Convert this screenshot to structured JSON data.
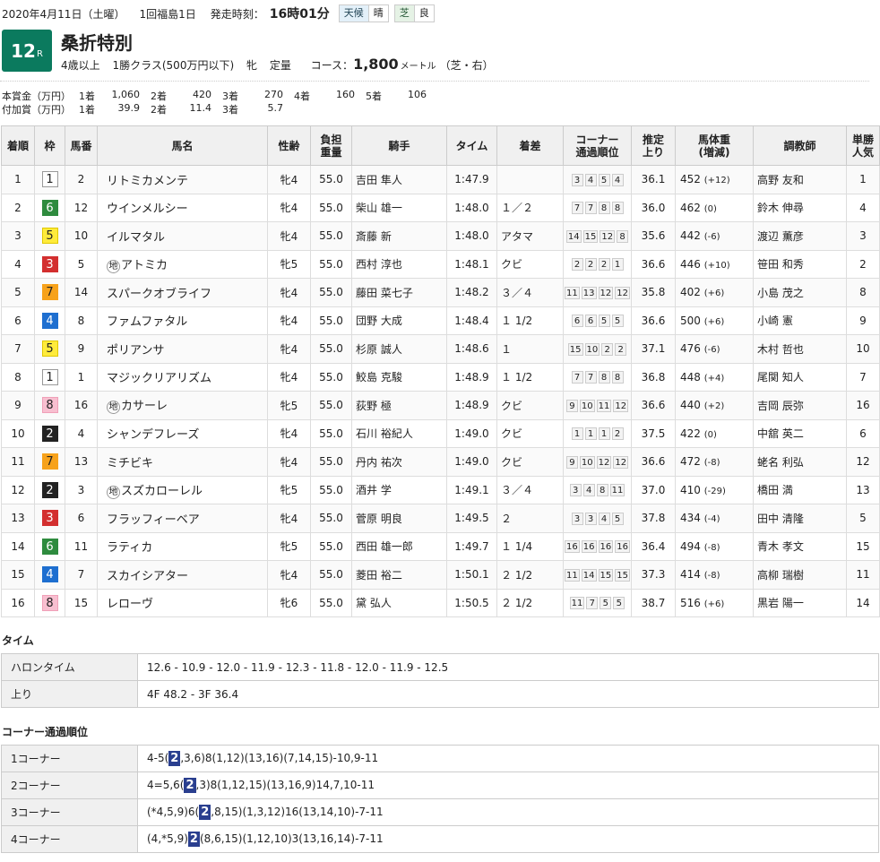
{
  "header": {
    "date": "2020年4月11日（土曜）",
    "meeting": "1回福島1日",
    "start_label": "発走時刻：",
    "start_time": "16時01分",
    "weather_label": "天候",
    "weather": "晴",
    "surface_label": "芝",
    "going": "良"
  },
  "race": {
    "number": "12",
    "suffix": "R",
    "name": "桑折特別",
    "age_cond": "4歳以上",
    "class": "1勝クラス(500万円以下)",
    "sex": "牝",
    "weight_rule": "定量",
    "course_label": "コース：",
    "distance": "1,800",
    "distance_unit": "メートル",
    "course_detail": "（芝・右）"
  },
  "prize": {
    "main_label": "本賞金（万円）",
    "main": [
      {
        "place": "1着",
        "value": "1,060"
      },
      {
        "place": "2着",
        "value": "420"
      },
      {
        "place": "3着",
        "value": "270"
      },
      {
        "place": "4着",
        "value": "160"
      },
      {
        "place": "5着",
        "value": "106"
      }
    ],
    "extra_label": "付加賞（万円）",
    "extra": [
      {
        "place": "1着",
        "value": "39.9"
      },
      {
        "place": "2着",
        "value": "11.4"
      },
      {
        "place": "3着",
        "value": "5.7"
      }
    ]
  },
  "columns": {
    "rank": "着順",
    "frame": "枠",
    "horse_no": "馬番",
    "name": "馬名",
    "sex_age": "性齢",
    "weight_top": "負担",
    "weight_bottom": "重量",
    "jockey": "騎手",
    "time": "タイム",
    "margin": "着差",
    "corner_top": "コーナー",
    "corner_bottom": "通過順位",
    "last3f_top": "推定",
    "last3f_bottom": "上り",
    "body_top": "馬体重",
    "body_bottom": "(増減)",
    "trainer": "調教師",
    "pop_top": "単勝",
    "pop_bottom": "人気"
  },
  "chihou_mark": "地",
  "frame_colors": {
    "1": {
      "bg": "#ffffff",
      "fg": "#222222",
      "border": "#999999"
    },
    "2": {
      "bg": "#222222",
      "fg": "#ffffff",
      "border": "#222222"
    },
    "3": {
      "bg": "#d32f2f",
      "fg": "#ffffff",
      "border": "#d32f2f"
    },
    "4": {
      "bg": "#1e6fd0",
      "fg": "#ffffff",
      "border": "#1e6fd0"
    },
    "5": {
      "bg": "#ffeb3b",
      "fg": "#222222",
      "border": "#e0c800"
    },
    "6": {
      "bg": "#2e8b3e",
      "fg": "#ffffff",
      "border": "#2e8b3e"
    },
    "7": {
      "bg": "#f7a21b",
      "fg": "#222222",
      "border": "#f7a21b"
    },
    "8": {
      "bg": "#f8bfd0",
      "fg": "#222222",
      "border": "#f0a0b8"
    }
  },
  "results": [
    {
      "rank": "1",
      "frame": "1",
      "no": "2",
      "chihou": false,
      "name": "リトミカメンテ",
      "sex_age": "牝4",
      "weight": "55.0",
      "jockey": "吉田 隼人",
      "time": "1:47.9",
      "margin": "",
      "corners": [
        "3",
        "4",
        "5",
        "4"
      ],
      "last3f": "36.1",
      "body": "452",
      "diff": "(+12)",
      "trainer": "高野 友和",
      "pop": "1"
    },
    {
      "rank": "2",
      "frame": "6",
      "no": "12",
      "chihou": false,
      "name": "ウインメルシー",
      "sex_age": "牝4",
      "weight": "55.0",
      "jockey": "柴山 雄一",
      "time": "1:48.0",
      "margin": "１／２",
      "corners": [
        "7",
        "7",
        "8",
        "8"
      ],
      "last3f": "36.0",
      "body": "462",
      "diff": "(0)",
      "trainer": "鈴木 伸尋",
      "pop": "4"
    },
    {
      "rank": "3",
      "frame": "5",
      "no": "10",
      "chihou": false,
      "name": "イルマタル",
      "sex_age": "牝4",
      "weight": "55.0",
      "jockey": "斎藤 新",
      "time": "1:48.0",
      "margin": "アタマ",
      "corners": [
        "14",
        "15",
        "12",
        "8"
      ],
      "last3f": "35.6",
      "body": "442",
      "diff": "(-6)",
      "trainer": "渡辺 薫彦",
      "pop": "3"
    },
    {
      "rank": "4",
      "frame": "3",
      "no": "5",
      "chihou": true,
      "name": "アトミカ",
      "sex_age": "牝5",
      "weight": "55.0",
      "jockey": "西村 淳也",
      "time": "1:48.1",
      "margin": "クビ",
      "corners": [
        "2",
        "2",
        "2",
        "1"
      ],
      "last3f": "36.6",
      "body": "446",
      "diff": "(+10)",
      "trainer": "笹田 和秀",
      "pop": "2"
    },
    {
      "rank": "5",
      "frame": "7",
      "no": "14",
      "chihou": false,
      "name": "スパークオブライフ",
      "sex_age": "牝4",
      "weight": "55.0",
      "jockey": "藤田 菜七子",
      "time": "1:48.2",
      "margin": "３／４",
      "corners": [
        "11",
        "13",
        "12",
        "12"
      ],
      "last3f": "35.8",
      "body": "402",
      "diff": "(+6)",
      "trainer": "小島 茂之",
      "pop": "8"
    },
    {
      "rank": "6",
      "frame": "4",
      "no": "8",
      "chihou": false,
      "name": "ファムファタル",
      "sex_age": "牝4",
      "weight": "55.0",
      "jockey": "団野 大成",
      "time": "1:48.4",
      "margin": "１ 1/2",
      "corners": [
        "6",
        "6",
        "5",
        "5"
      ],
      "last3f": "36.6",
      "body": "500",
      "diff": "(+6)",
      "trainer": "小崎 憲",
      "pop": "9"
    },
    {
      "rank": "7",
      "frame": "5",
      "no": "9",
      "chihou": false,
      "name": "ポリアンサ",
      "sex_age": "牝4",
      "weight": "55.0",
      "jockey": "杉原 誠人",
      "time": "1:48.6",
      "margin": "１",
      "corners": [
        "15",
        "10",
        "2",
        "2"
      ],
      "last3f": "37.1",
      "body": "476",
      "diff": "(-6)",
      "trainer": "木村 哲也",
      "pop": "10"
    },
    {
      "rank": "8",
      "frame": "1",
      "no": "1",
      "chihou": false,
      "name": "マジックリアリズム",
      "sex_age": "牝4",
      "weight": "55.0",
      "jockey": "鮫島 克駿",
      "time": "1:48.9",
      "margin": "１ 1/2",
      "corners": [
        "7",
        "7",
        "8",
        "8"
      ],
      "last3f": "36.8",
      "body": "448",
      "diff": "(+4)",
      "trainer": "尾関 知人",
      "pop": "7"
    },
    {
      "rank": "9",
      "frame": "8",
      "no": "16",
      "chihou": true,
      "name": "カサーレ",
      "sex_age": "牝5",
      "weight": "55.0",
      "jockey": "荻野 極",
      "time": "1:48.9",
      "margin": "クビ",
      "corners": [
        "9",
        "10",
        "11",
        "12"
      ],
      "last3f": "36.6",
      "body": "440",
      "diff": "(+2)",
      "trainer": "吉岡 辰弥",
      "pop": "16"
    },
    {
      "rank": "10",
      "frame": "2",
      "no": "4",
      "chihou": false,
      "name": "シャンデフレーズ",
      "sex_age": "牝4",
      "weight": "55.0",
      "jockey": "石川 裕紀人",
      "time": "1:49.0",
      "margin": "クビ",
      "corners": [
        "1",
        "1",
        "1",
        "2"
      ],
      "last3f": "37.5",
      "body": "422",
      "diff": "(0)",
      "trainer": "中舘 英二",
      "pop": "6"
    },
    {
      "rank": "11",
      "frame": "7",
      "no": "13",
      "chihou": false,
      "name": "ミチビキ",
      "sex_age": "牝4",
      "weight": "55.0",
      "jockey": "丹内 祐次",
      "time": "1:49.0",
      "margin": "クビ",
      "corners": [
        "9",
        "10",
        "12",
        "12"
      ],
      "last3f": "36.6",
      "body": "472",
      "diff": "(-8)",
      "trainer": "蛯名 利弘",
      "pop": "12"
    },
    {
      "rank": "12",
      "frame": "2",
      "no": "3",
      "chihou": true,
      "name": "スズカローレル",
      "sex_age": "牝5",
      "weight": "55.0",
      "jockey": "酒井 学",
      "time": "1:49.1",
      "margin": "３／４",
      "corners": [
        "3",
        "4",
        "8",
        "11"
      ],
      "last3f": "37.0",
      "body": "410",
      "diff": "(-29)",
      "trainer": "橋田 満",
      "pop": "13"
    },
    {
      "rank": "13",
      "frame": "3",
      "no": "6",
      "chihou": false,
      "name": "フラッフィーベア",
      "sex_age": "牝4",
      "weight": "55.0",
      "jockey": "菅原 明良",
      "time": "1:49.5",
      "margin": "２",
      "corners": [
        "3",
        "3",
        "4",
        "5"
      ],
      "last3f": "37.8",
      "body": "434",
      "diff": "(-4)",
      "trainer": "田中 清隆",
      "pop": "5"
    },
    {
      "rank": "14",
      "frame": "6",
      "no": "11",
      "chihou": false,
      "name": "ラティカ",
      "sex_age": "牝5",
      "weight": "55.0",
      "jockey": "西田 雄一郎",
      "time": "1:49.7",
      "margin": "１ 1/4",
      "corners": [
        "16",
        "16",
        "16",
        "16"
      ],
      "last3f": "36.4",
      "body": "494",
      "diff": "(-8)",
      "trainer": "青木 孝文",
      "pop": "15"
    },
    {
      "rank": "15",
      "frame": "4",
      "no": "7",
      "chihou": false,
      "name": "スカイシアター",
      "sex_age": "牝4",
      "weight": "55.0",
      "jockey": "菱田 裕二",
      "time": "1:50.1",
      "margin": "２ 1/2",
      "corners": [
        "11",
        "14",
        "15",
        "15"
      ],
      "last3f": "37.3",
      "body": "414",
      "diff": "(-8)",
      "trainer": "高柳 瑞樹",
      "pop": "11"
    },
    {
      "rank": "16",
      "frame": "8",
      "no": "15",
      "chihou": false,
      "name": "レローヴ",
      "sex_age": "牝6",
      "weight": "55.0",
      "jockey": "黛 弘人",
      "time": "1:50.5",
      "margin": "２ 1/2",
      "corners": [
        "11",
        "7",
        "5",
        "5"
      ],
      "last3f": "38.7",
      "body": "516",
      "diff": "(+6)",
      "trainer": "黒岩 陽一",
      "pop": "14"
    }
  ],
  "time_section": {
    "title": "タイム",
    "halon_label": "ハロンタイム",
    "halon": "12.6 - 10.9 - 12.0 - 11.9 - 12.3 - 11.8 - 12.0 - 11.9 - 12.5",
    "agari_label": "上り",
    "agari": "4F 48.2 - 3F 36.4"
  },
  "corner_section": {
    "title": "コーナー通過順位",
    "rows": [
      {
        "label": "1コーナー",
        "before": "4-5(",
        "hl": "2",
        "after": ",3,6)8(1,12)(13,16)(7,14,15)-10,9-11"
      },
      {
        "label": "2コーナー",
        "before": "4=5,6(",
        "hl": "2",
        "after": ",3)8(1,12,15)(13,16,9)14,7,10-11"
      },
      {
        "label": "3コーナー",
        "before": "(*4,5,9)6(",
        "hl": "2",
        "after": ",8,15)(1,3,12)16(13,14,10)-7-11"
      },
      {
        "label": "4コーナー",
        "before": "(4,*5,9)",
        "hl": "2",
        "after": "(8,6,15)(1,12,10)3(13,16,14)-7-11"
      }
    ]
  }
}
